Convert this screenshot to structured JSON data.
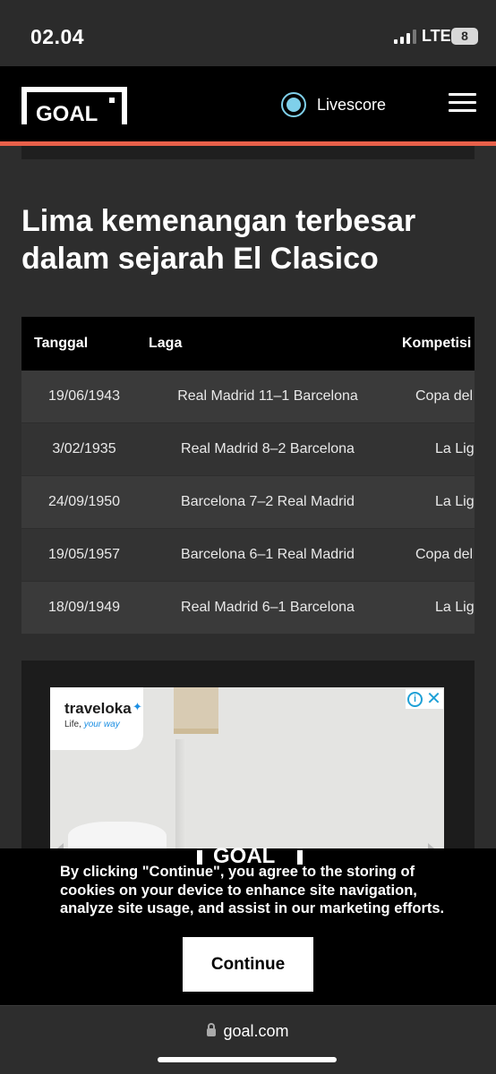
{
  "status_bar": {
    "time": "02.04",
    "network": "LTE",
    "battery": "8"
  },
  "header": {
    "logo_text": "GOAL",
    "livescore_label": "Livescore"
  },
  "article": {
    "title": "Lima kemenangan terbesar dalam sejarah El Clasico"
  },
  "table": {
    "headers": {
      "date": "Tanggal",
      "match": "Laga",
      "competition": "Kompetisi"
    },
    "rows": [
      {
        "date": "19/06/1943",
        "match": "Real Madrid 11–1 Barcelona",
        "competition": "Copa del"
      },
      {
        "date": "3/02/1935",
        "match": "Real Madrid 8–2 Barcelona",
        "competition": "La Lig"
      },
      {
        "date": "24/09/1950",
        "match": "Barcelona 7–2 Real Madrid",
        "competition": "La Lig"
      },
      {
        "date": "19/05/1957",
        "match": "Barcelona 6–1 Real Madrid",
        "competition": "Copa del"
      },
      {
        "date": "18/09/1949",
        "match": "Real Madrid 6–1 Barcelona",
        "competition": "La Lig"
      }
    ]
  },
  "ad": {
    "brand": "traveloka",
    "tagline_prefix": "Life,",
    "tagline_accent": "your way"
  },
  "cookie_banner": {
    "logo_text": "GOAL",
    "text": "By clicking \"Continue\", you agree to the storing of cookies on your device to enhance site navigation, analyze site usage, and assist in our marketing efforts.",
    "button_label": "Continue"
  },
  "browser": {
    "url": "goal.com"
  },
  "colors": {
    "accent": "#e8604a",
    "live": "#7fd0ea",
    "header_bg": "#000000",
    "page_bg": "#2d2d2d"
  }
}
